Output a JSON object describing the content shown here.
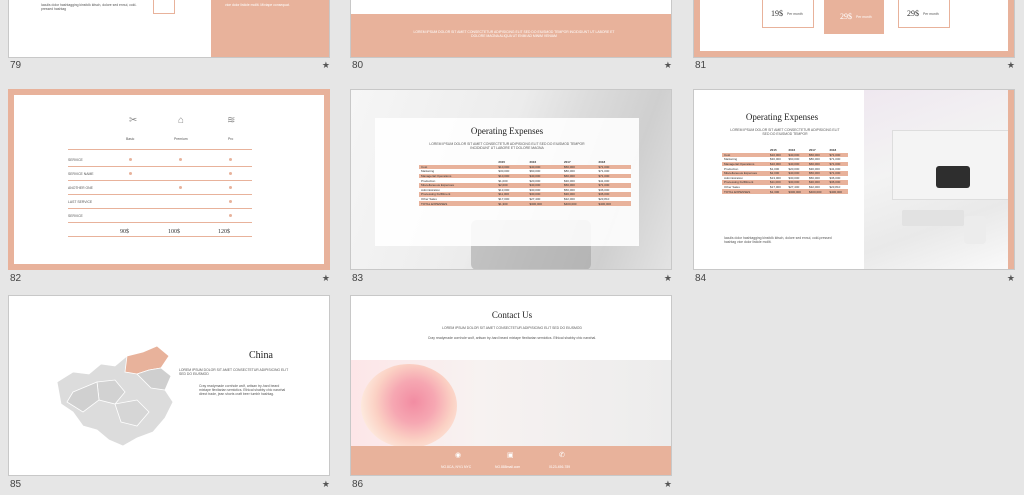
{
  "slides": [
    {
      "num": "79",
      "text1": "Iaculis dolor hashtagging kinsfolk kitsch, dolore sed ennui, cold-pressed hashtag",
      "text2": "vice dolor listicle mollit. Mixtape consequat.",
      "text3": "Iaculis dolor hashtagging kinsfolk kitsch sunt, aute chillwave Sartorial."
    },
    {
      "num": "80",
      "text": "LOREM IPSUM DOLOR SIT AMET CONSECTETUR ADIPISICING ELIT SED DO EIUSMOD TEMPOR INCIDIDUNT UT LABORE ET DOLORE MAGNA ALIQUA UT ENIM AD MINIM VENIAM"
    },
    {
      "num": "81",
      "prices": [
        "19$",
        "29$",
        "29$"
      ],
      "price_unit": "Per month"
    },
    {
      "num": "82",
      "plans": [
        "Basic",
        "Premium",
        "Pro"
      ],
      "services": [
        "SERVICE",
        "SERVICE NAME",
        "ANOTHER ONE",
        "LAST SERVICE",
        "SERVICE"
      ],
      "prices": [
        "90$",
        "100$",
        "120$"
      ],
      "price_unit": "Per month"
    },
    {
      "num": "83",
      "title": "Operating Expenses",
      "subtitle": "LOREM IPSUM DOLOR SIT AMET CONSECTETUR ADIPISICING ELIT SED DO EIUSMOD TEMPOR INCIDIDUNT UT LABORE ET DOLORE MAGNA"
    },
    {
      "num": "84",
      "title": "Operating Expenses",
      "subtitle": "LOREM IPSUM DOLOR SIT AMET CONSECTETUR ADIPISICING ELIT SED DO EIUSMOD TEMPOR",
      "note": "Iaculis dolor hashtagging kinsfolk kitsch, dolore sed ennui, cold-pressed hashtag vice dolor listicle mollit."
    },
    {
      "num": "85",
      "title": "China",
      "subtitle": "LOREM IPSUM DOLOR SIT AMET CONSECTETUR ADIPISICING ELIT SED DO EIUSMOD",
      "body": "Cray readymade cornhole wolf, artisan try-hard beard mixtape flexitarian semiotics. Ethical shabby chic narwhal direct trade, jean shorts craft beer tumblr hashtag."
    },
    {
      "num": "86",
      "title": "Contact Us",
      "subtitle": "LOREM IPSUM DOLOR SIT AMET CONSECTETUR ADIPISICING ELIT SED DO EIUSMOD",
      "body": "Cray readymade cornhole wolf, artisan try-hard beard mixtape flexitarian semiotics. Ethical shabby chic narwhal.",
      "contacts": [
        "NO.8CA, NY/1 NYC",
        "NO.888mail.com",
        "0123-456-789"
      ]
    }
  ],
  "table": {
    "headers": [
      "",
      "2015",
      "2016",
      "2017",
      "2018"
    ],
    "rows": [
      [
        "Cost",
        "$10,000",
        "$40,000",
        "$50,000",
        "$71,000"
      ],
      [
        "Marketing",
        "$30,000",
        "$60,000",
        "$80,000",
        "$71,000"
      ],
      [
        "Managerial Operations",
        "$10,000",
        "$40,000",
        "$60,000",
        "$71,000"
      ],
      [
        "Production",
        "$1,000",
        "$20,000",
        "$30,000",
        "$41,000"
      ],
      [
        "Miscellaneous Expenses",
        "$2,000",
        "$40,000",
        "$50,000",
        "$71,000"
      ],
      [
        "Administration",
        "$13,000",
        "$30,000",
        "$50,000",
        "$36,000"
      ],
      [
        "Processing Fulfillment",
        "$11,000",
        "$30,000",
        "$30,000",
        "$36,000"
      ],
      [
        "Other Sales",
        "$17,000",
        "$27,400",
        "$32,000",
        "$23,810"
      ],
      [
        "TOTAL EXPENSES",
        "$1,300",
        "$300,000",
        "$400,000",
        "$400,000"
      ]
    ]
  },
  "star": "★",
  "colors": {
    "accent": "#e8b29b",
    "background": "#e6e6e6"
  }
}
